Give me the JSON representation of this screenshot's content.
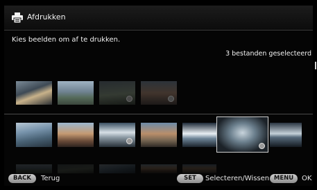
{
  "header": {
    "title": "Afdrukken",
    "icon": "printer-icon"
  },
  "instruction": "Kies beelden om af te drukken.",
  "selection_count": "3 bestanden geselecteerd",
  "footer": {
    "back_key": "BACK",
    "back_label": "Terug",
    "set_key": "SET",
    "set_label": "Selecteren/Wissen",
    "menu_key": "MENU",
    "menu_label": "OK"
  }
}
